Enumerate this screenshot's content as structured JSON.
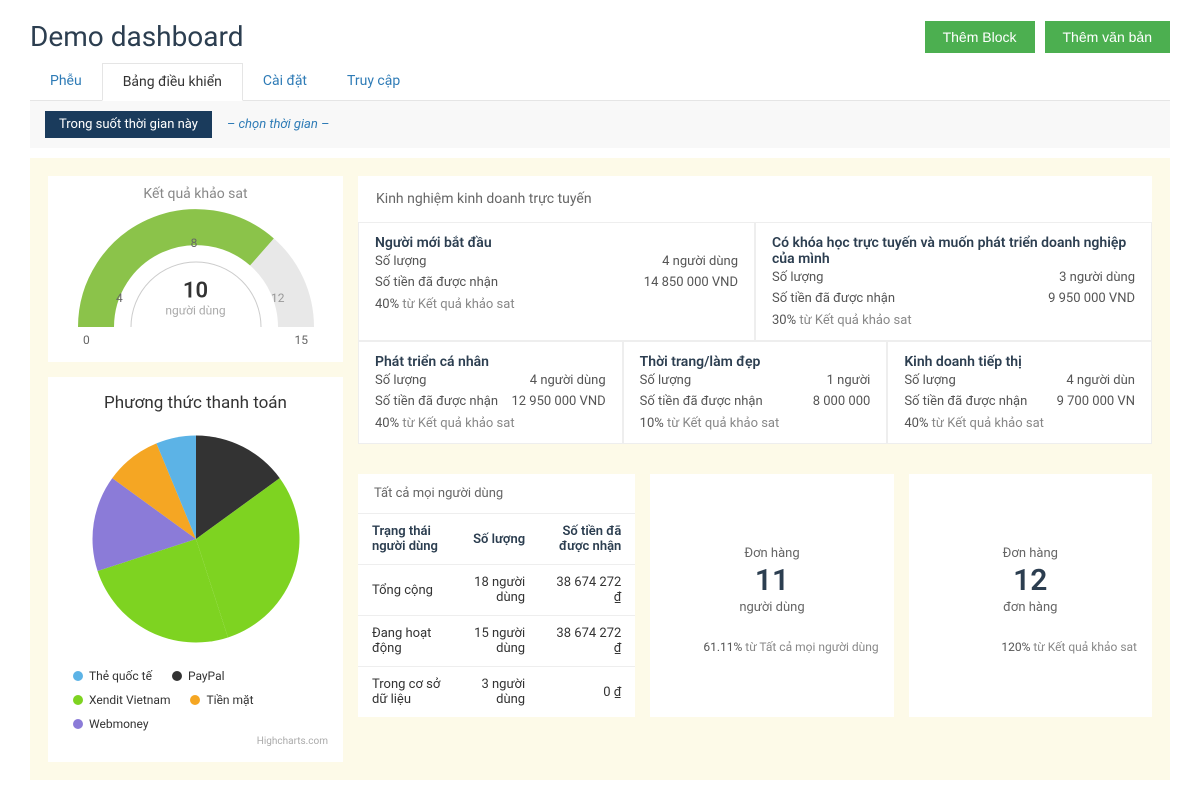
{
  "header": {
    "title": "Demo dashboard",
    "add_block": "Thêm Block",
    "add_text": "Thêm văn bản"
  },
  "tabs": [
    {
      "label": "Phễu",
      "active": false
    },
    {
      "label": "Bảng điều khiển",
      "active": true
    },
    {
      "label": "Cài đặt",
      "active": false
    },
    {
      "label": "Truy cập",
      "active": false
    }
  ],
  "filter": {
    "period": "Trong suốt thời gian này",
    "choose": "– chọn thời gian –"
  },
  "gauge": {
    "title": "Kết quả khảo sat",
    "value": "10",
    "unit": "người dùng",
    "min": "0",
    "max": "15",
    "tick4": "4",
    "tick8": "8",
    "tick12": "12"
  },
  "pie": {
    "title": "Phương thức thanh toán",
    "legend": [
      {
        "name": "Thẻ quốc tế",
        "color": "#5cb3e6"
      },
      {
        "name": "PayPal",
        "color": "#333333"
      },
      {
        "name": "Xendit Vietnam",
        "color": "#7ed321"
      },
      {
        "name": "Tiền mặt",
        "color": "#f5a623"
      },
      {
        "name": "Webmoney",
        "color": "#8b7bd8"
      }
    ],
    "credit": "Highcharts.com"
  },
  "experience": {
    "title": "Kinh nghiệm kinh doanh trực tuyến",
    "sl_label": "Số lượng",
    "st_label": "Số tiền đã được nhận",
    "footer_suffix": " từ Kết quả khảo sat",
    "cells": [
      {
        "head": "Người mới bắt đầu",
        "sl": "4 người dùng",
        "st": "14 850 000 VND",
        "pct": "40%",
        "size": "half"
      },
      {
        "head": "Có khóa học trực tuyến và muốn phát triển doanh nghiệp của mình",
        "sl": "3 người dùng",
        "st": "9 950 000 VND",
        "pct": "30%",
        "size": "half"
      },
      {
        "head": "Phát triển cá nhân",
        "sl": "4 người dùng",
        "st": "12 950 000 VND",
        "pct": "40%",
        "size": "third"
      },
      {
        "head": "Thời trang/làm đẹp",
        "sl": "1 người",
        "st": "8 000 000",
        "pct": "10%",
        "size": "third"
      },
      {
        "head": "Kinh doanh tiếp thị",
        "sl": "4 người dùn",
        "st": "9 700 000 VN",
        "pct": "40%",
        "size": "third"
      }
    ]
  },
  "users_table": {
    "title": "Tất cả mọi người dùng",
    "h1": "Trạng thái người dùng",
    "h2": "Số lượng",
    "h3": "Số tiền đã được nhận",
    "rows": [
      {
        "c1": "Tổng cộng",
        "c2": "18 người dùng",
        "c3": "38 674 272 ₫"
      },
      {
        "c1": "Đang hoạt động",
        "c2": "15 người dùng",
        "c3": "38 674 272 ₫"
      },
      {
        "c1": "Trong cơ sở dữ liệu",
        "c2": "3 người dùng",
        "c3": "0 ₫"
      }
    ]
  },
  "stat1": {
    "label": "Đơn hàng",
    "value": "11",
    "unit": "người dùng",
    "pct": "61.11%",
    "footer": " từ Tất cả mọi người dùng"
  },
  "stat2": {
    "label": "Đơn hàng",
    "value": "12",
    "unit": "đơn hàng",
    "pct": "120%",
    "footer": " từ Kết quả khảo sat"
  },
  "chart_data": [
    {
      "type": "gauge",
      "title": "Kết quả khảo sat",
      "value": 10,
      "min": 0,
      "max": 15,
      "unit": "người dùng",
      "ticks": [
        4,
        8,
        12
      ]
    },
    {
      "type": "pie",
      "title": "Phương thức thanh toán",
      "series": [
        {
          "name": "Xendit Vietnam",
          "value": 48,
          "color": "#7ed321"
        },
        {
          "name": "PayPal",
          "value": 15,
          "color": "#333333"
        },
        {
          "name": "Thẻ quốc tế",
          "value": 10,
          "color": "#5cb3e6"
        },
        {
          "name": "Webmoney",
          "value": 17,
          "color": "#8b7bd8"
        },
        {
          "name": "Tiền mặt",
          "value": 10,
          "color": "#f5a623"
        }
      ]
    }
  ]
}
